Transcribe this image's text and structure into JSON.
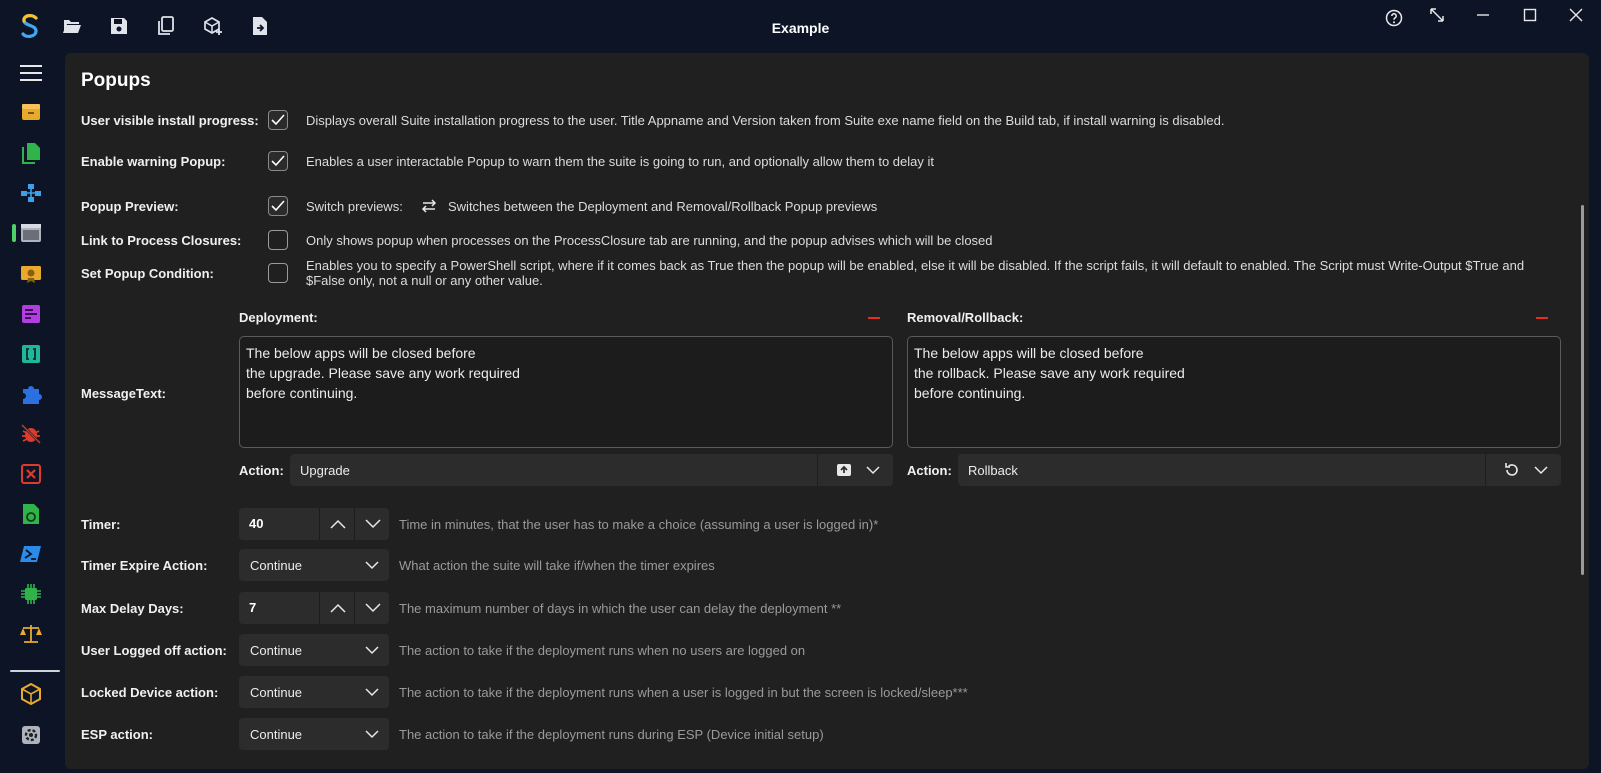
{
  "window": {
    "title": "Example"
  },
  "toolbar": {
    "icons": [
      "app-logo-icon",
      "folder-open-icon",
      "save-icon",
      "copy-icon",
      "package-add-icon",
      "file-export-icon"
    ]
  },
  "window_controls": [
    "help-icon",
    "resize-icon",
    "minimize-icon",
    "maximize-icon",
    "close-icon"
  ],
  "sidebar": {
    "items": [
      "menu-icon",
      "box-icon",
      "files-icon",
      "network-icon",
      "window-icon",
      "certificate-icon",
      "form-icon",
      "braces-icon",
      "puzzle-icon",
      "bug-off-icon",
      "close-box-icon",
      "script-file-icon",
      "powershell-icon",
      "chip-icon",
      "scales-icon",
      "cube-icon",
      "settings-icon"
    ],
    "active_item": "window-icon"
  },
  "page": {
    "title": "Popups"
  },
  "rows": {
    "install_progress": {
      "label": "User visible install progress:",
      "checked": true,
      "description": "Displays overall Suite installation progress to the user. Title Appname and Version taken from Suite exe name field on the Build tab, if install warning is disabled."
    },
    "warning_popup": {
      "label": "Enable warning Popup:",
      "checked": true,
      "description": "Enables a user interactable Popup to warn them the suite is going to run, and optionally allow them to delay it"
    },
    "popup_preview": {
      "label": "Popup Preview:",
      "checked": true,
      "switch_label": "Switch previews:",
      "description": "Switches between the Deployment and Removal/Rollback Popup previews"
    },
    "process_closures": {
      "label": "Link to Process Closures:",
      "checked": false,
      "description": "Only shows popup when processes on the ProcessClosure tab are running, and the popup advises which will be closed"
    },
    "popup_condition": {
      "label": "Set Popup Condition:",
      "checked": false,
      "description": "Enables you to specify a PowerShell script, where if it comes back as True then the popup will be enabled, else it will be disabled. If the script fails, it will default to enabled. The Script must Write-Output $True and $False only, not a null or any other value."
    }
  },
  "message": {
    "label": "MessageText:",
    "deployment": {
      "header": "Deployment:",
      "lines": [
        "The below apps will be closed before",
        "the upgrade. Please save any work required",
        "before continuing."
      ],
      "action_label": "Action:",
      "action_value": "Upgrade"
    },
    "removal": {
      "header": "Removal/Rollback:",
      "lines": [
        "The below apps will be closed before",
        "the rollback. Please save any work required",
        "before continuing."
      ],
      "action_label": "Action:",
      "action_value": "Rollback"
    }
  },
  "settings": {
    "timer": {
      "label": "Timer:",
      "value": "40",
      "hint": "Time in minutes, that the user has to make a choice (assuming a user is logged in)*"
    },
    "timer_expire": {
      "label": "Timer Expire Action:",
      "value": "Continue",
      "hint": "What action the suite will take if/when the timer expires"
    },
    "max_delay": {
      "label": "Max Delay Days:",
      "value": "7",
      "hint": "The maximum number of days in which the user can delay the deployment **"
    },
    "logged_off": {
      "label": "User Logged off action:",
      "value": "Continue",
      "hint": "The action to take if the deployment runs when no users are logged on"
    },
    "locked_device": {
      "label": "Locked Device action:",
      "value": "Continue",
      "hint": "The action to take if the deployment runs when a user is logged in but the screen is locked/sleep***"
    },
    "esp": {
      "label": "ESP action:",
      "value": "Continue",
      "hint": "The action to take if the deployment runs during ESP (Device initial setup)"
    }
  },
  "colors": {
    "accent_active": "#4fd16a",
    "remove_red": "#e0301e",
    "panel_bg": "#202020",
    "window_bg": "#0d1426"
  }
}
